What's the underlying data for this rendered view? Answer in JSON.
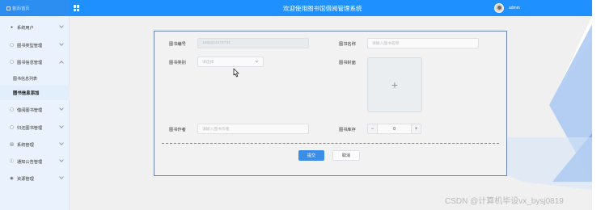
{
  "header": {
    "brand": "首页/首页",
    "title": "欢迎使用图书馆借阅管理系统",
    "username": "admin",
    "bg_color": "#1e90ff"
  },
  "sidebar": {
    "items": [
      {
        "label": "系统用户",
        "icon": "user-icon"
      },
      {
        "label": "图书类型管理",
        "icon": "edit-icon"
      },
      {
        "label": "图书信息管理",
        "icon": "edit-icon"
      }
    ],
    "sub_items": [
      {
        "label": "图书信息列表"
      },
      {
        "label": "图书信息添加"
      }
    ],
    "items2": [
      {
        "label": "借阅图书管理",
        "icon": "edit-icon"
      },
      {
        "label": "归还图书管理",
        "icon": "edit-icon"
      },
      {
        "label": "系统管理",
        "icon": "image-icon"
      },
      {
        "label": "通知公告管理",
        "icon": "info-icon"
      },
      {
        "label": "资源管理",
        "icon": "bulb-icon"
      }
    ]
  },
  "form": {
    "book_no_label": "图书编号",
    "book_no_value": "1665204976734",
    "book_name_label": "图书名称",
    "book_name_placeholder": "请输入图书名称",
    "book_type_label": "图书类别",
    "book_type_placeholder": "请选择",
    "cover_label": "图书封面",
    "author_label": "图书作者",
    "author_placeholder": "请输入图书作者",
    "stock_label": "图书库存",
    "stock_value": "0",
    "minus": "−",
    "plus": "+",
    "upload_plus": "+",
    "submit": "提交",
    "cancel": "取消"
  },
  "watermark": "CSDN @计算机毕设vx_bysj0819"
}
